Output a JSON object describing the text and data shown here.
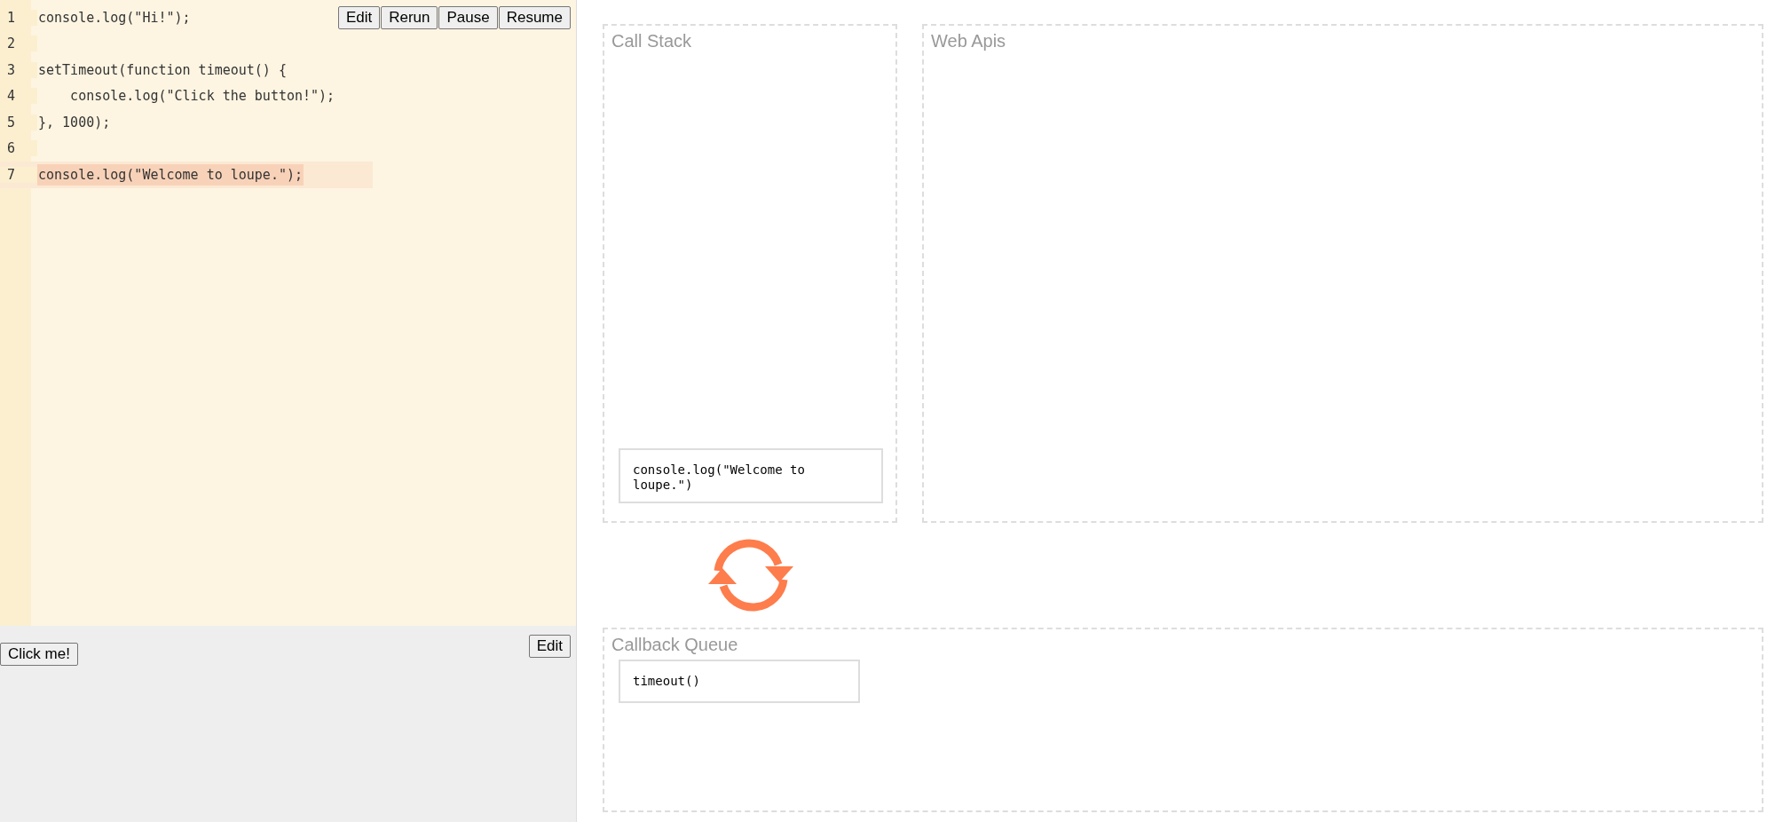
{
  "editor": {
    "lines": [
      {
        "number": "1",
        "code": "console.log(\"Hi!\");",
        "highlighted": false
      },
      {
        "number": "2",
        "highlighted": false
      },
      {
        "number": "3",
        "code": "setTimeout(function timeout() {",
        "highlighted": false
      },
      {
        "number": "4",
        "code": "    console.log(\"Click the button!\");",
        "highlighted": false
      },
      {
        "number": "5",
        "code": "}, 1000);",
        "highlighted": false
      },
      {
        "number": "6",
        "highlighted": false
      },
      {
        "number": "7",
        "code": "console.log(\"Welcome to loupe.\");",
        "highlighted": true
      }
    ],
    "buttons": [
      "Edit",
      "Rerun",
      "Pause",
      "Resume"
    ]
  },
  "html_panel": {
    "button": "Click me!",
    "edit_button": "Edit"
  },
  "call_stack": {
    "title": "Call Stack",
    "frames": [
      "console.log(\"Welcome to loupe.\")"
    ]
  },
  "web_apis": {
    "title": "Web Apis"
  },
  "callback_queue": {
    "title": "Callback Queue",
    "items": [
      "timeout()"
    ]
  }
}
